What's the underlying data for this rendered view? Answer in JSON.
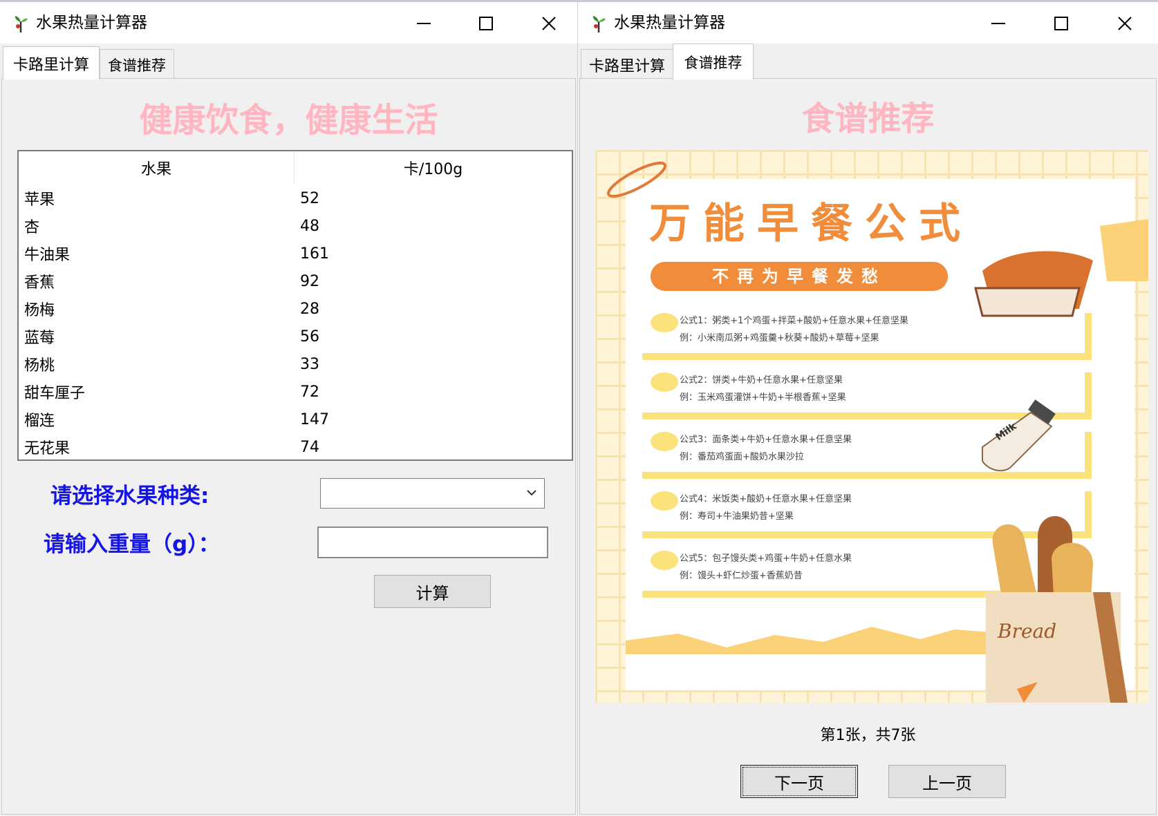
{
  "left_window": {
    "title": "水果热量计算器",
    "tabs": [
      {
        "label": "卡路里计算",
        "active": true
      },
      {
        "label": "食谱推荐",
        "active": false
      }
    ],
    "headline": "健康饮食，健康生活",
    "headline_color": "#ffb6c1",
    "table": {
      "columns": [
        "水果",
        "卡/100g"
      ],
      "rows": [
        [
          "苹果",
          "52"
        ],
        [
          "杏",
          "48"
        ],
        [
          "牛油果",
          "161"
        ],
        [
          "香蕉",
          "92"
        ],
        [
          "杨梅",
          "28"
        ],
        [
          "蓝莓",
          "56"
        ],
        [
          "杨桃",
          "33"
        ],
        [
          "甜车厘子",
          "72"
        ],
        [
          "榴连",
          "147"
        ],
        [
          "无花果",
          "74"
        ]
      ]
    },
    "form": {
      "fruit_label": "请选择水果种类:",
      "fruit_value": "",
      "weight_label": "请输入重量（g）：",
      "weight_value": "",
      "calc_button": "计算",
      "label_color": "#1414e6"
    }
  },
  "right_window": {
    "title": "水果热量计算器",
    "tabs": [
      {
        "label": "卡路里计算",
        "active": false
      },
      {
        "label": "食谱推荐",
        "active": true
      }
    ],
    "headline": "食谱推荐",
    "poster": {
      "title": "万能早餐公式",
      "subtitle": "不再为早餐发愁",
      "formulas": [
        {
          "formula": "公式1：粥类+1个鸡蛋+拌菜+酸奶+任意水果+任意坚果",
          "example": "例：小米南瓜粥+鸡蛋羹+秋葵+酸奶+草莓+坚果"
        },
        {
          "formula": "公式2：饼类+牛奶+任意水果+任意坚果",
          "example": "例：玉米鸡蛋灌饼+牛奶+半根香蕉+坚果"
        },
        {
          "formula": "公式3：面条类+牛奶+任意水果+任意坚果",
          "example": "例：番茄鸡蛋面+酸奶水果沙拉"
        },
        {
          "formula": "公式4：米饭类+酸奶+任意水果+任意坚果",
          "example": "例：寿司+牛油果奶昔+坚果"
        },
        {
          "formula": "公式5：包子馒头类+鸡蛋+牛奶+任意水果",
          "example": "例：馒头+虾仁炒蛋+香蕉奶昔"
        }
      ],
      "milk_label": "Milk",
      "bread_label": "Bread",
      "accent": "#f08c3a"
    },
    "page_info": "第1张，共7张",
    "next_button": "下一页",
    "prev_button": "上一页"
  }
}
